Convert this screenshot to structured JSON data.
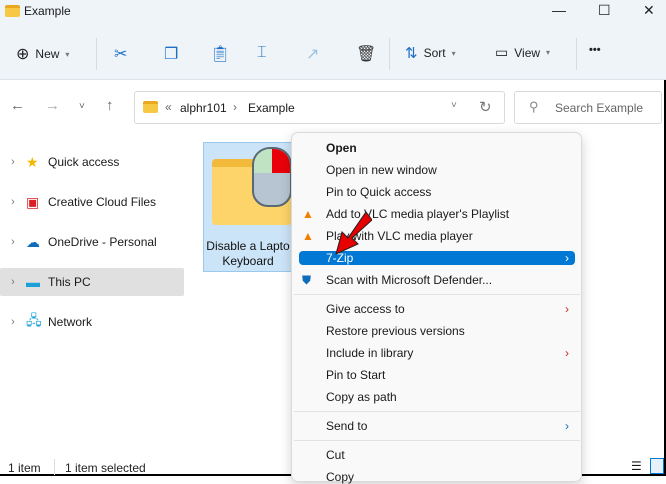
{
  "window": {
    "title": "Example",
    "minimize": "—",
    "maximize": "☐",
    "close": "✕"
  },
  "toolbar": {
    "new_label": "New",
    "sort_label": "Sort",
    "view_label": "View",
    "more": "•••"
  },
  "address": {
    "prefix": "«",
    "crumbs": [
      "alphr101",
      "Example"
    ],
    "sep": "›"
  },
  "search": {
    "placeholder": "Search Example"
  },
  "sidebar": {
    "items": [
      {
        "label": "Quick access"
      },
      {
        "label": "Creative Cloud Files"
      },
      {
        "label": "OneDrive - Personal"
      },
      {
        "label": "This PC"
      },
      {
        "label": "Network"
      }
    ]
  },
  "file": {
    "name_line1": "Disable a Lapto",
    "name_line2": "Keyboard"
  },
  "menu": {
    "items": [
      "Open",
      "Open in new window",
      "Pin to Quick access",
      "Add to VLC media player's Playlist",
      "Play with VLC media player",
      "7-Zip",
      "Scan with Microsoft Defender...",
      "Give access to",
      "Restore previous versions",
      "Include in library",
      "Pin to Start",
      "Copy as path",
      "Send to",
      "Cut",
      "Copy"
    ]
  },
  "status": {
    "count": "1 item",
    "selected": "1 item selected"
  },
  "colors": {
    "accent": "#0078d4",
    "arrow": "#e60000"
  }
}
